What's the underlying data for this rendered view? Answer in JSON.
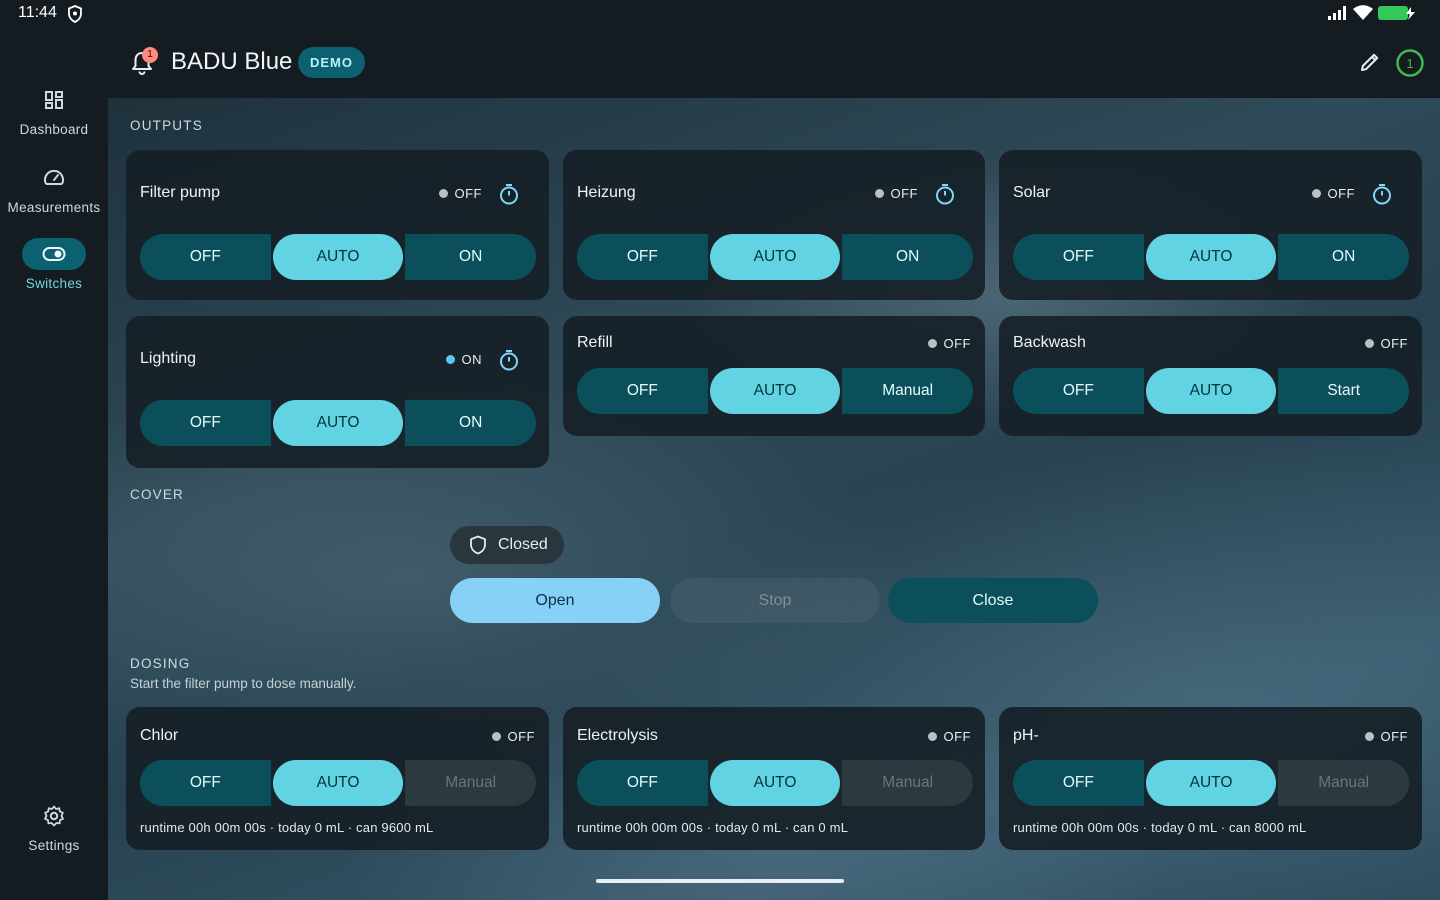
{
  "status_bar": {
    "time": "11:44"
  },
  "nav": {
    "items": [
      {
        "label": "Dashboard",
        "icon": "dashboard-icon",
        "active": false
      },
      {
        "label": "Measurements",
        "icon": "gauge-icon",
        "active": false
      },
      {
        "label": "Switches",
        "icon": "toggle-icon",
        "active": true
      }
    ],
    "settings_label": "Settings"
  },
  "header": {
    "title": "BADU Blue",
    "badge": "DEMO",
    "notification_count": "1",
    "timer_count": "1"
  },
  "outputs": {
    "section_label": "OUTPUTS",
    "cards": [
      {
        "title": "Filter pump",
        "state": "OFF",
        "buttons": [
          "OFF",
          "AUTO",
          "ON"
        ]
      },
      {
        "title": "Heizung",
        "state": "OFF",
        "buttons": [
          "OFF",
          "AUTO",
          "ON"
        ]
      },
      {
        "title": "Solar",
        "state": "OFF",
        "buttons": [
          "OFF",
          "AUTO",
          "ON"
        ]
      },
      {
        "title": "Lighting",
        "state": "ON",
        "buttons": [
          "OFF",
          "AUTO",
          "ON"
        ]
      },
      {
        "title": "Refill",
        "state": "OFF",
        "buttons": [
          "OFF",
          "AUTO",
          "Manual"
        ]
      },
      {
        "title": "Backwash",
        "state": "OFF",
        "buttons": [
          "OFF",
          "AUTO",
          "Start"
        ]
      }
    ]
  },
  "cover": {
    "section_label": "COVER",
    "status": "Closed",
    "open_label": "Open",
    "stop_label": "Stop",
    "close_label": "Close"
  },
  "dosing": {
    "section_label": "DOSING",
    "note": "Start the filter pump to dose manually.",
    "cards": [
      {
        "title": "Chlor",
        "state": "OFF",
        "buttons": [
          "OFF",
          "AUTO",
          "Manual"
        ],
        "runtime": "runtime 00h 00m 00s · today 0 mL · can 9600 mL"
      },
      {
        "title": "Electrolysis",
        "state": "OFF",
        "buttons": [
          "OFF",
          "AUTO",
          "Manual"
        ],
        "runtime": "runtime 00h 00m 00s · today 0 mL · can 0 mL"
      },
      {
        "title": "pH-",
        "state": "OFF",
        "buttons": [
          "OFF",
          "AUTO",
          "Manual"
        ],
        "runtime": "runtime 00h 00m 00s · today 0 mL · can 8000 mL"
      }
    ]
  },
  "colors": {
    "accent": "#62d3e2",
    "segment_dark": "#0b4f5a",
    "open_button": "#86d1f5",
    "status_on": "#5cc8f0",
    "battery": "#34c759"
  }
}
